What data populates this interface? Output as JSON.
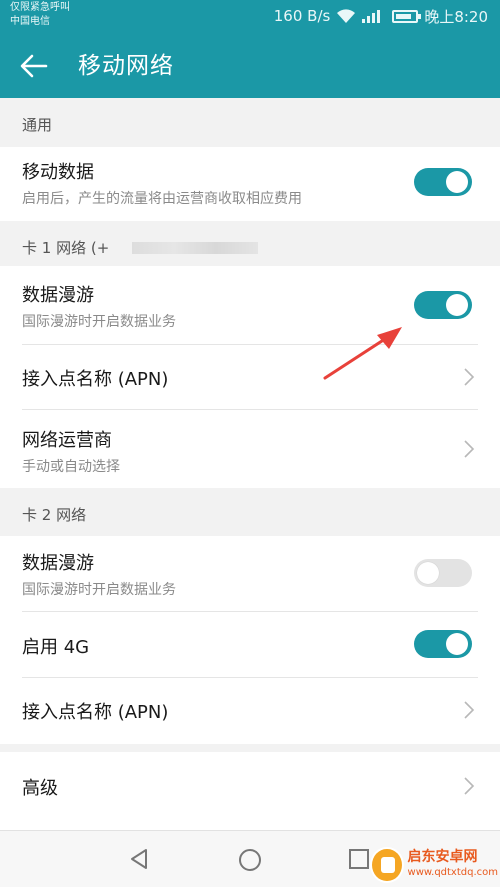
{
  "status_bar": {
    "carrier_line1": "仅限紧急呼叫",
    "carrier_line2": "中国电信",
    "speed": "160 B/s",
    "time": "晚上8:20"
  },
  "header": {
    "title": "移动网络"
  },
  "general": {
    "header": "通用",
    "mobile_data": {
      "title": "移动数据",
      "subtitle": "启用后，产生的流量将由运营商收取相应费用",
      "enabled": true
    }
  },
  "sim1": {
    "header": "卡 1 网络 (+",
    "roaming": {
      "title": "数据漫游",
      "subtitle": "国际漫游时开启数据业务",
      "enabled": true
    },
    "apn": {
      "title": "接入点名称 (APN)"
    },
    "operator": {
      "title": "网络运营商",
      "subtitle": "手动或自动选择"
    }
  },
  "sim2": {
    "header": "卡 2 网络",
    "roaming": {
      "title": "数据漫游",
      "subtitle": "国际漫游时开启数据业务",
      "enabled": false
    },
    "enable_4g": {
      "title": "启用 4G",
      "enabled": true
    },
    "apn": {
      "title": "接入点名称 (APN)"
    }
  },
  "advanced": {
    "title": "高级"
  },
  "watermark": {
    "name": "启东安卓网",
    "url": "www.qdtxtdq.com"
  },
  "colors": {
    "accent": "#1b98a6",
    "annotation_arrow": "#e8413a"
  }
}
